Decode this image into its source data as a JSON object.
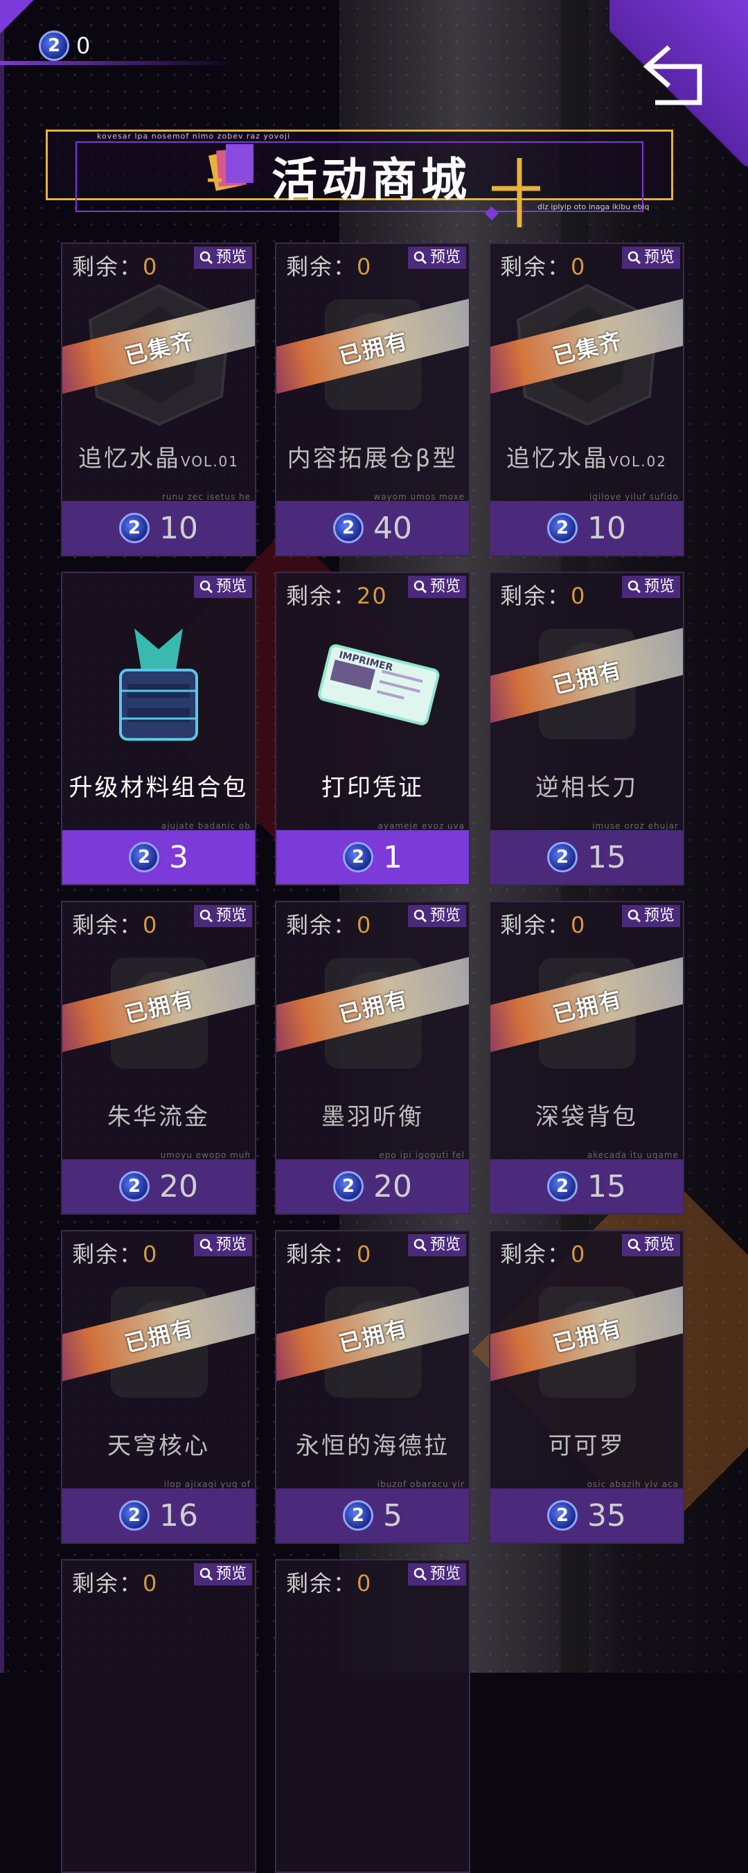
{
  "currency": {
    "value": "0"
  },
  "title": "活动商城",
  "title_micro_left": "kovesar lpa nosemof nimo zobev raz yovoji",
  "title_micro_right": "diz iplyip oto inaga ikibu ebiq",
  "labels": {
    "remain": "剩余：",
    "preview": "预览"
  },
  "items": [
    {
      "remain": "0",
      "status": "已集齐",
      "name": "追忆水晶",
      "vol": "VOL.01",
      "micro": "runu zec isetus he",
      "price": "10",
      "active": false
    },
    {
      "remain": "0",
      "status": "已拥有",
      "name": "内容拓展仓β型",
      "vol": "",
      "micro": "wayom umos moxe",
      "price": "40",
      "active": false
    },
    {
      "remain": "0",
      "status": "已集齐",
      "name": "追忆水晶",
      "vol": "VOL.02",
      "micro": "igilove yiluf sufido",
      "price": "10",
      "active": false
    },
    {
      "remain": "",
      "status": "",
      "name": "升级材料组合包",
      "vol": "",
      "micro": "ajujate badanic ob",
      "price": "3",
      "active": true,
      "art": "crate"
    },
    {
      "remain": "20",
      "status": "",
      "name": "打印凭证",
      "vol": "",
      "micro": "ayameje evoz uva",
      "price": "1",
      "active": true,
      "art": "ticket",
      "ticket_text": "IMPRIMER"
    },
    {
      "remain": "0",
      "status": "已拥有",
      "name": "逆相长刀",
      "vol": "",
      "micro": "imuse oroz ehujar",
      "price": "15",
      "active": false
    },
    {
      "remain": "0",
      "status": "已拥有",
      "name": "朱华流金",
      "vol": "",
      "micro": "umoyu ewopo muh",
      "price": "20",
      "active": false
    },
    {
      "remain": "0",
      "status": "已拥有",
      "name": "墨羽听衡",
      "vol": "",
      "micro": "epo ipi igoguti fel",
      "price": "20",
      "active": false
    },
    {
      "remain": "0",
      "status": "已拥有",
      "name": "深袋背包",
      "vol": "",
      "micro": "akecada itu uqame",
      "price": "15",
      "active": false
    },
    {
      "remain": "0",
      "status": "已拥有",
      "name": "天穹核心",
      "vol": "",
      "micro": "ilop ajixaqi yuq of",
      "price": "16",
      "active": false
    },
    {
      "remain": "0",
      "status": "已拥有",
      "name": "永恒的海德拉",
      "vol": "",
      "micro": "ibuzof obaracu yir",
      "price": "5",
      "active": false
    },
    {
      "remain": "0",
      "status": "已拥有",
      "name": "可可罗",
      "vol": "",
      "micro": "osic abazih ylv aca",
      "price": "35",
      "active": false
    },
    {
      "remain": "0",
      "status": "",
      "name": "",
      "vol": "",
      "micro": "",
      "price": "",
      "active": false
    },
    {
      "remain": "0",
      "status": "",
      "name": "",
      "vol": "",
      "micro": "",
      "price": "",
      "active": false
    }
  ]
}
